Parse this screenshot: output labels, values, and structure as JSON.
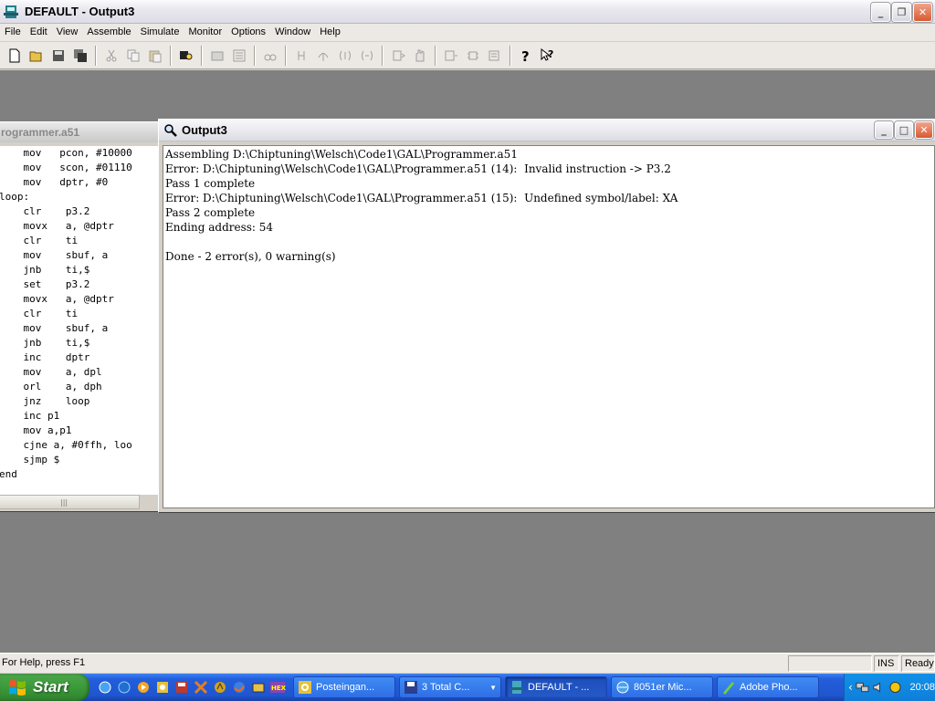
{
  "window": {
    "title": "DEFAULT - Output3"
  },
  "menu": [
    "File",
    "Edit",
    "View",
    "Assemble",
    "Simulate",
    "Monitor",
    "Options",
    "Window",
    "Help"
  ],
  "toolbar_icons": [
    "new-icon",
    "open-icon",
    "save-icon",
    "save-all-icon",
    "cut-icon",
    "copy-icon",
    "paste-icon",
    "find-icon",
    "build-icon",
    "build-all-icon",
    "goto-icon",
    "step-into-icon",
    "step-over-icon",
    "step-out-icon",
    "run-to-cursor-icon",
    "reset-icon",
    "stop-icon",
    "breakpoint-icon",
    "memory-icon",
    "registers-icon",
    "help-icon",
    "context-help-icon"
  ],
  "code_window": {
    "title": "rogrammer.a51",
    "lines": [
      "    mov   pcon, #10000",
      "    mov   scon, #01110",
      "    mov   dptr, #0",
      "loop:",
      "    clr    p3.2",
      "    movx   a, @dptr",
      "    clr    ti",
      "    mov    sbuf, a",
      "    jnb    ti,$",
      "    set    p3.2",
      "    movx   a, @dptr",
      "    clr    ti",
      "    mov    sbuf, a",
      "    jnb    ti,$",
      "    inc    dptr",
      "    mov    a, dpl",
      "    orl    a, dph",
      "    jnz    loop",
      "    inc p1",
      "    mov a,p1",
      "    cjne a, #0ffh, loo",
      "    sjmp $",
      "end"
    ]
  },
  "output_window": {
    "title": "Output3",
    "lines": [
      "Assembling D:\\Chiptuning\\Welsch\\Code1\\GAL\\Programmer.a51",
      "Error: D:\\Chiptuning\\Welsch\\Code1\\GAL\\Programmer.a51 (14):  Invalid instruction -> P3.2",
      "Pass 1 complete",
      "Error: D:\\Chiptuning\\Welsch\\Code1\\GAL\\Programmer.a51 (15):  Undefined symbol/label: XA",
      "Pass 2 complete",
      "Ending address: 54",
      "",
      "Done - 2 error(s), 0 warning(s)"
    ]
  },
  "status": {
    "help": "For Help, press F1",
    "ins": "INS",
    "ready": "Ready"
  },
  "taskbar": {
    "start": "Start",
    "tasks": [
      {
        "label": "Posteingan...",
        "icon": "outlook-icon",
        "active": false
      },
      {
        "label": "3 Total C...",
        "icon": "floppy-icon",
        "active": false
      },
      {
        "label": "DEFAULT - ...",
        "icon": "assembler-icon",
        "active": true
      },
      {
        "label": "8051er Mic...",
        "icon": "ie-icon",
        "active": false
      },
      {
        "label": "Adobe Pho...",
        "icon": "photoshop-icon",
        "active": false
      }
    ],
    "clock": "20:08"
  }
}
